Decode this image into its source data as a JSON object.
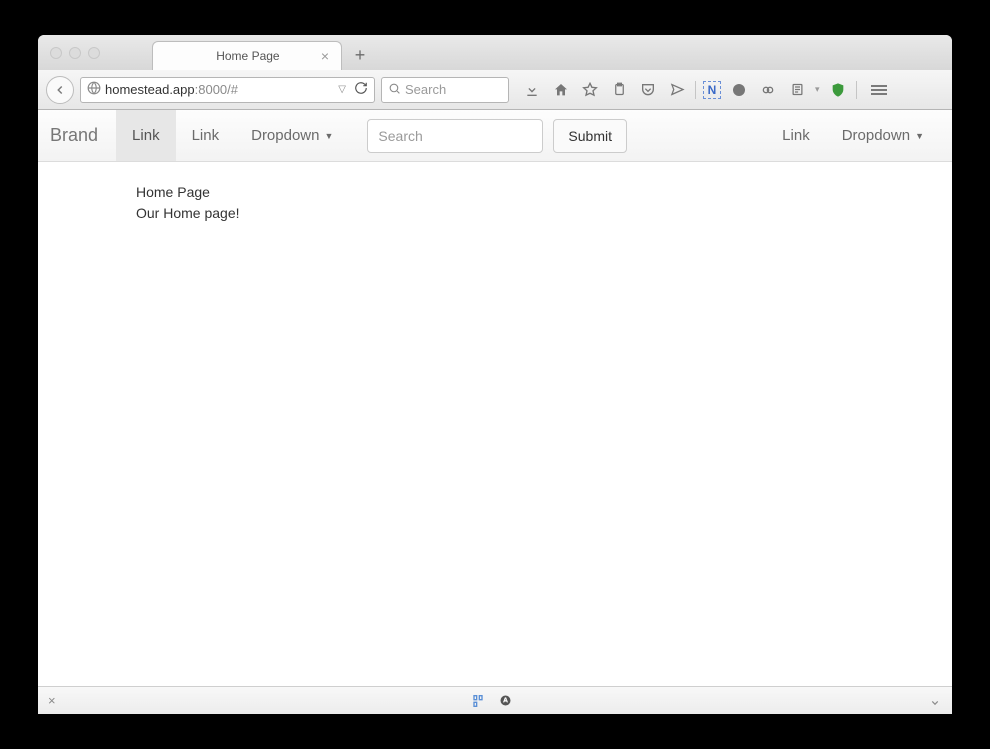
{
  "browser": {
    "tabs": [
      {
        "label": "Home Page"
      }
    ],
    "url": {
      "host": "homestead.app",
      "port_path": ":8000/#"
    },
    "search_placeholder": "Search",
    "icons": {
      "back": "back-icon",
      "globe": "globe-icon",
      "reload": "reload-icon",
      "search": "search-icon",
      "download": "download-icon",
      "home": "home-icon",
      "star": "star-icon",
      "clipboard": "clipboard-icon",
      "pocket": "pocket-icon",
      "send": "send-icon",
      "note": "note-icon",
      "face": "face-icon",
      "cloud": "cloud-icon",
      "card": "card-icon",
      "shield": "shield-icon",
      "menu": "hamburger-icon"
    }
  },
  "navbar": {
    "brand": "Brand",
    "left": {
      "link1": "Link",
      "link2": "Link",
      "dropdown1": "Dropdown"
    },
    "search_placeholder": "Search",
    "submit_label": "Submit",
    "right": {
      "link": "Link",
      "dropdown": "Dropdown"
    }
  },
  "page": {
    "line1": "Home Page",
    "line2": "Our Home page!"
  }
}
